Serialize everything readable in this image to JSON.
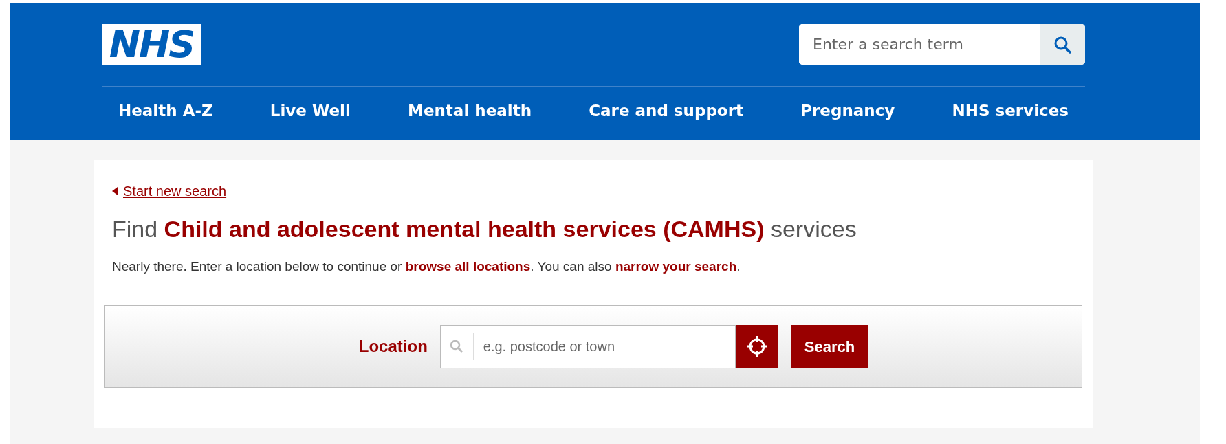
{
  "header": {
    "logo": "NHS",
    "search": {
      "placeholder": "Enter a search term"
    },
    "nav": [
      "Health A-Z",
      "Live Well",
      "Mental health",
      "Care and support",
      "Pregnancy",
      "NHS services"
    ]
  },
  "back_link": "Start new search",
  "heading": "Find **Child and adolescent mental health services (CAMHS)** services",
  "intro": [
    {
      "kind": "text",
      "text": "Nearly there. Enter a location below to continue or "
    },
    {
      "kind": "link",
      "text": "browse all locations"
    },
    {
      "kind": "text",
      "text": ". You can also "
    },
    {
      "kind": "link",
      "text": "narrow your search"
    },
    {
      "kind": "text",
      "text": "."
    }
  ],
  "location_search": {
    "label": "Location",
    "placeholder": "e.g. postcode or town",
    "button": "Search"
  }
}
